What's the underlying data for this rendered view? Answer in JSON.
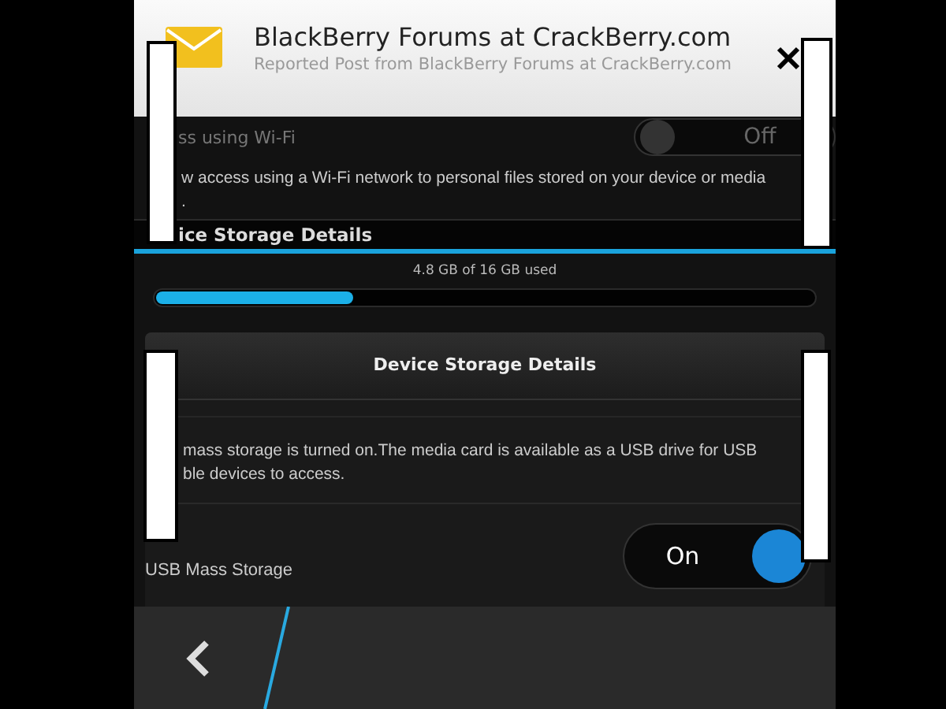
{
  "notification": {
    "title": "BlackBerry Forums at CrackBerry.com",
    "subtitle": "Reported Post from BlackBerry Forums at CrackBerry.com"
  },
  "wifi_access": {
    "label": "ss using Wi-Fi",
    "toggle": {
      "label": "Off",
      "on": false
    },
    "description_lines": [
      "w access using a Wi-Fi network to personal files stored on your device or media",
      "."
    ]
  },
  "section_header": "ice Storage Details",
  "storage": {
    "reading": "4.8 GB of 16 GB used",
    "level": 0.3
  },
  "dialog": {
    "title": "Device Storage Details",
    "description_lines": [
      "mass storage is turned on.The media card is available as a USB drive for USB",
      "ble devices to access."
    ],
    "usb": {
      "label": "USB Mass Storage",
      "toggle": {
        "label": "On",
        "on": true
      }
    }
  }
}
